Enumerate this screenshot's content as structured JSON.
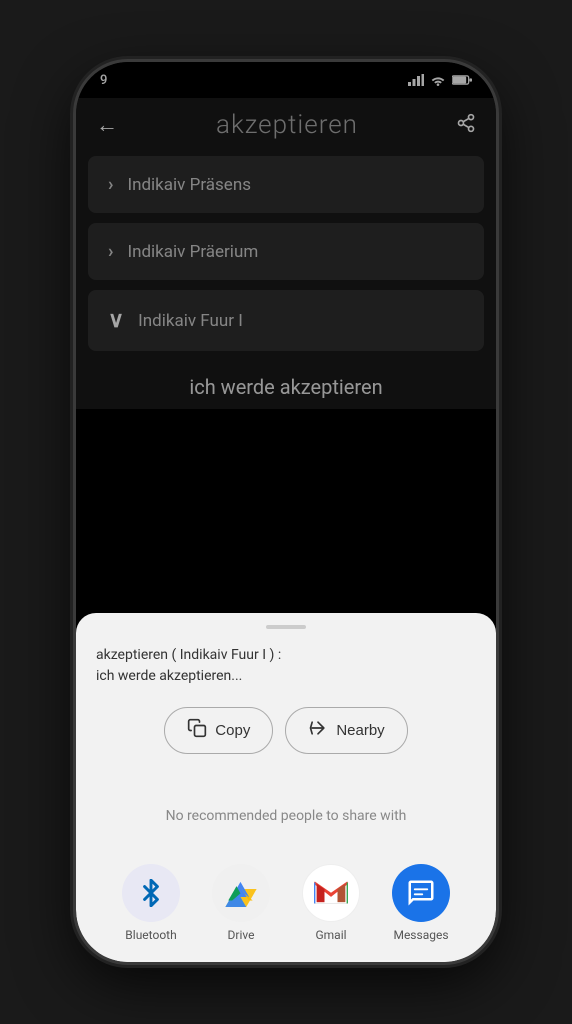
{
  "phone": {
    "status_bar": {
      "time": "9",
      "battery_icon": "battery",
      "signal_icon": "signal"
    }
  },
  "app": {
    "header": {
      "back_label": "←",
      "title": "akzeptieren",
      "share_label": "⬆"
    },
    "accordion": [
      {
        "id": "praesens",
        "label": "Indikaiv Präsens",
        "chevron": "›",
        "expanded": false
      },
      {
        "id": "praerium",
        "label": "Indikaiv Präerium",
        "chevron": "›",
        "expanded": false
      },
      {
        "id": "fuur",
        "label": "Indikaiv Fuur I",
        "chevron": "˅",
        "expanded": true
      }
    ],
    "conjugation": "ich werde akzeptieren"
  },
  "share_sheet": {
    "content_preview_line1": "akzeptieren ( Indikaiv Fuur I )  :",
    "content_preview_line2": "ich werde akzeptieren...",
    "buttons": [
      {
        "id": "copy",
        "label": "Copy",
        "icon": "copy"
      },
      {
        "id": "nearby",
        "label": "Nearby",
        "icon": "nearby"
      }
    ],
    "no_recommend_text": "No recommended people to share with"
  },
  "app_icons": [
    {
      "id": "bluetooth",
      "label": "Bluetooth",
      "bg_color": "#e8e8f4",
      "icon": "bluetooth"
    },
    {
      "id": "drive",
      "label": "Drive",
      "bg_color": "#f0f0f0",
      "icon": "drive"
    },
    {
      "id": "gmail",
      "label": "Gmail",
      "bg_color": "#f0f0f0",
      "icon": "gmail"
    },
    {
      "id": "messages",
      "label": "Messages",
      "bg_color": "#1a73e8",
      "icon": "messages"
    }
  ]
}
